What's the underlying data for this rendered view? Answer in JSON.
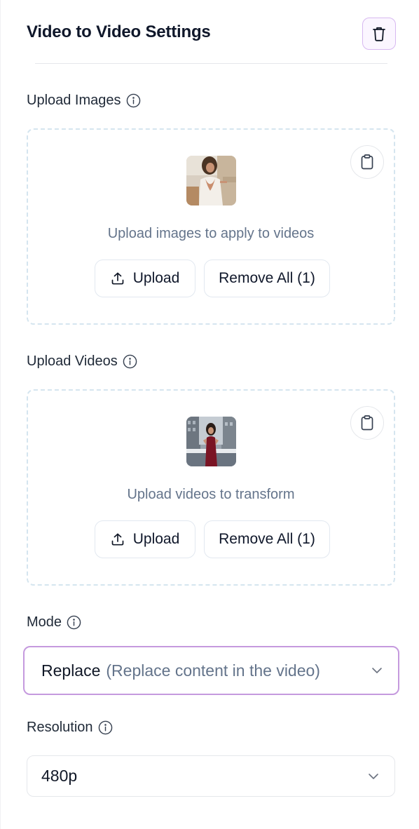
{
  "header": {
    "title": "Video to Video Settings",
    "trash_icon": "trash-icon"
  },
  "images": {
    "label": "Upload Images",
    "description": "Upload images to apply to videos",
    "upload_label": "Upload",
    "remove_label": "Remove All (1)"
  },
  "videos": {
    "label": "Upload Videos",
    "description": "Upload videos to transform",
    "upload_label": "Upload",
    "remove_label": "Remove All (1)"
  },
  "mode": {
    "label": "Mode",
    "value": "Replace",
    "value_description": "(Replace content in the video)"
  },
  "resolution": {
    "label": "Resolution",
    "value": "480p"
  },
  "colors": {
    "accent_border": "#c59ade",
    "dashed_border": "#d5e5ef",
    "muted_text": "#64748b"
  }
}
